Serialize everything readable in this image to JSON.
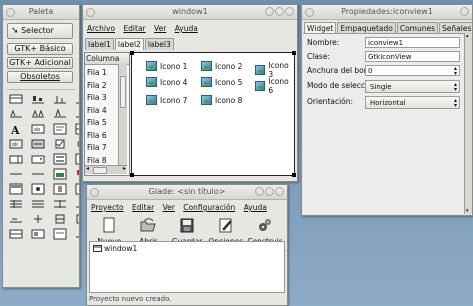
{
  "palette": {
    "title": "Paleta",
    "selector_label": "Selector",
    "groups": [
      "GTK+ Básico",
      "GTK+ Adicional",
      "Obsoletos"
    ]
  },
  "widget_window": {
    "title": "window1",
    "menu": [
      "Archivo",
      "Editar",
      "Ver",
      "Ayuda"
    ],
    "tabs": [
      "label1",
      "label2",
      "label3"
    ],
    "column_header": "Columna",
    "rows": [
      "Fila 1",
      "Fila 2",
      "Fila 3",
      "Fila 4",
      "Fila 5",
      "Fila 6",
      "Fila 7",
      "Fila 8"
    ],
    "icons": [
      "Icono 1",
      "Icono 2",
      "Icono 3",
      "Icono 4",
      "Icono 5",
      "Icono 6",
      "Icono 7",
      "Icono 8"
    ]
  },
  "properties": {
    "title": "Propiedades:iconview1",
    "tabs": [
      "Widget",
      "Empaquetado",
      "Comunes",
      "Señales"
    ],
    "fields": [
      {
        "label": "Nombre:",
        "value": "iconview1",
        "kind": "text"
      },
      {
        "label": "Clase:",
        "value": "GtkIconView",
        "kind": "text"
      },
      {
        "label": "Anchura del bor",
        "value": "0",
        "kind": "spin"
      },
      {
        "label": "Modo de selecc",
        "value": "Single",
        "kind": "combo"
      },
      {
        "label": "Orientación:",
        "value": "Horizontal",
        "kind": "combo"
      }
    ]
  },
  "glade": {
    "title": "Glade: <sin título>",
    "menu": [
      "Proyecto",
      "Editar",
      "Ver",
      "Configuración",
      "Ayuda"
    ],
    "toolbar": [
      "Nuevo",
      "Abrir",
      "Guardar",
      "Opciones",
      "Construir"
    ],
    "tree_item": "window1",
    "status": "Proyecto nuevo creado."
  },
  "colors": {
    "desktop": "#7c9bb9",
    "window_bg": "#e6e6e2",
    "selection": "#3c6ea6"
  }
}
